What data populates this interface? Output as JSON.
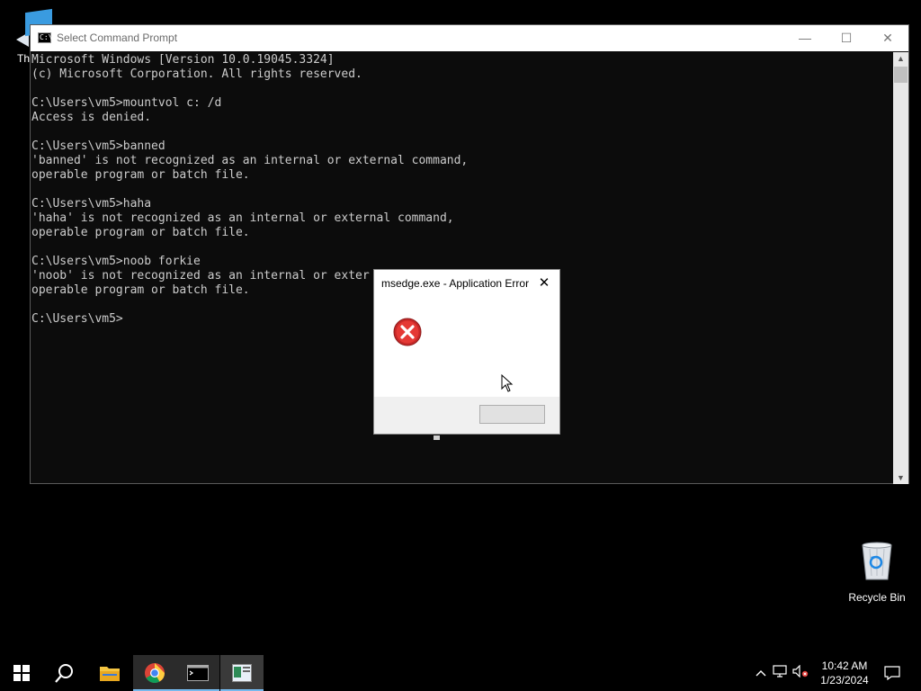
{
  "desktop": {
    "partial_icon_label": "Th",
    "recycle_bin_label": "Recycle Bin"
  },
  "cmd_window": {
    "title": "Select Command Prompt",
    "icon_text": "C:\\",
    "controls": {
      "minimize": "—",
      "maximize": "☐",
      "close": "✕"
    },
    "lines": [
      "Microsoft Windows [Version 10.0.19045.3324]",
      "(c) Microsoft Corporation. All rights reserved.",
      "",
      "C:\\Users\\vm5>mountvol c: /d",
      "Access is denied.",
      "",
      "C:\\Users\\vm5>banned",
      "'banned' is not recognized as an internal or external command,",
      "operable program or batch file.",
      "",
      "C:\\Users\\vm5>haha",
      "'haha' is not recognized as an internal or external command,",
      "operable program or batch file.",
      "",
      "C:\\Users\\vm5>noob forkie",
      "'noob' is not recognized as an internal or exter",
      "operable program or batch file.",
      "",
      "C:\\Users\\vm5>"
    ]
  },
  "error_dialog": {
    "title": "msedge.exe - Application Error",
    "close_glyph": "✕",
    "ok_label": ""
  },
  "taskbar": {
    "apps": [
      "start",
      "search",
      "file-explorer",
      "chrome",
      "command-prompt",
      "app"
    ],
    "clock_time": "10:42 AM",
    "clock_date": "1/23/2024",
    "tray_chevron": "^"
  },
  "colors": {
    "console_bg": "#0c0c0c",
    "console_fg": "#cccccc",
    "taskbar_active_underline": "#76b9ed",
    "error_red": "#d32f2f"
  }
}
